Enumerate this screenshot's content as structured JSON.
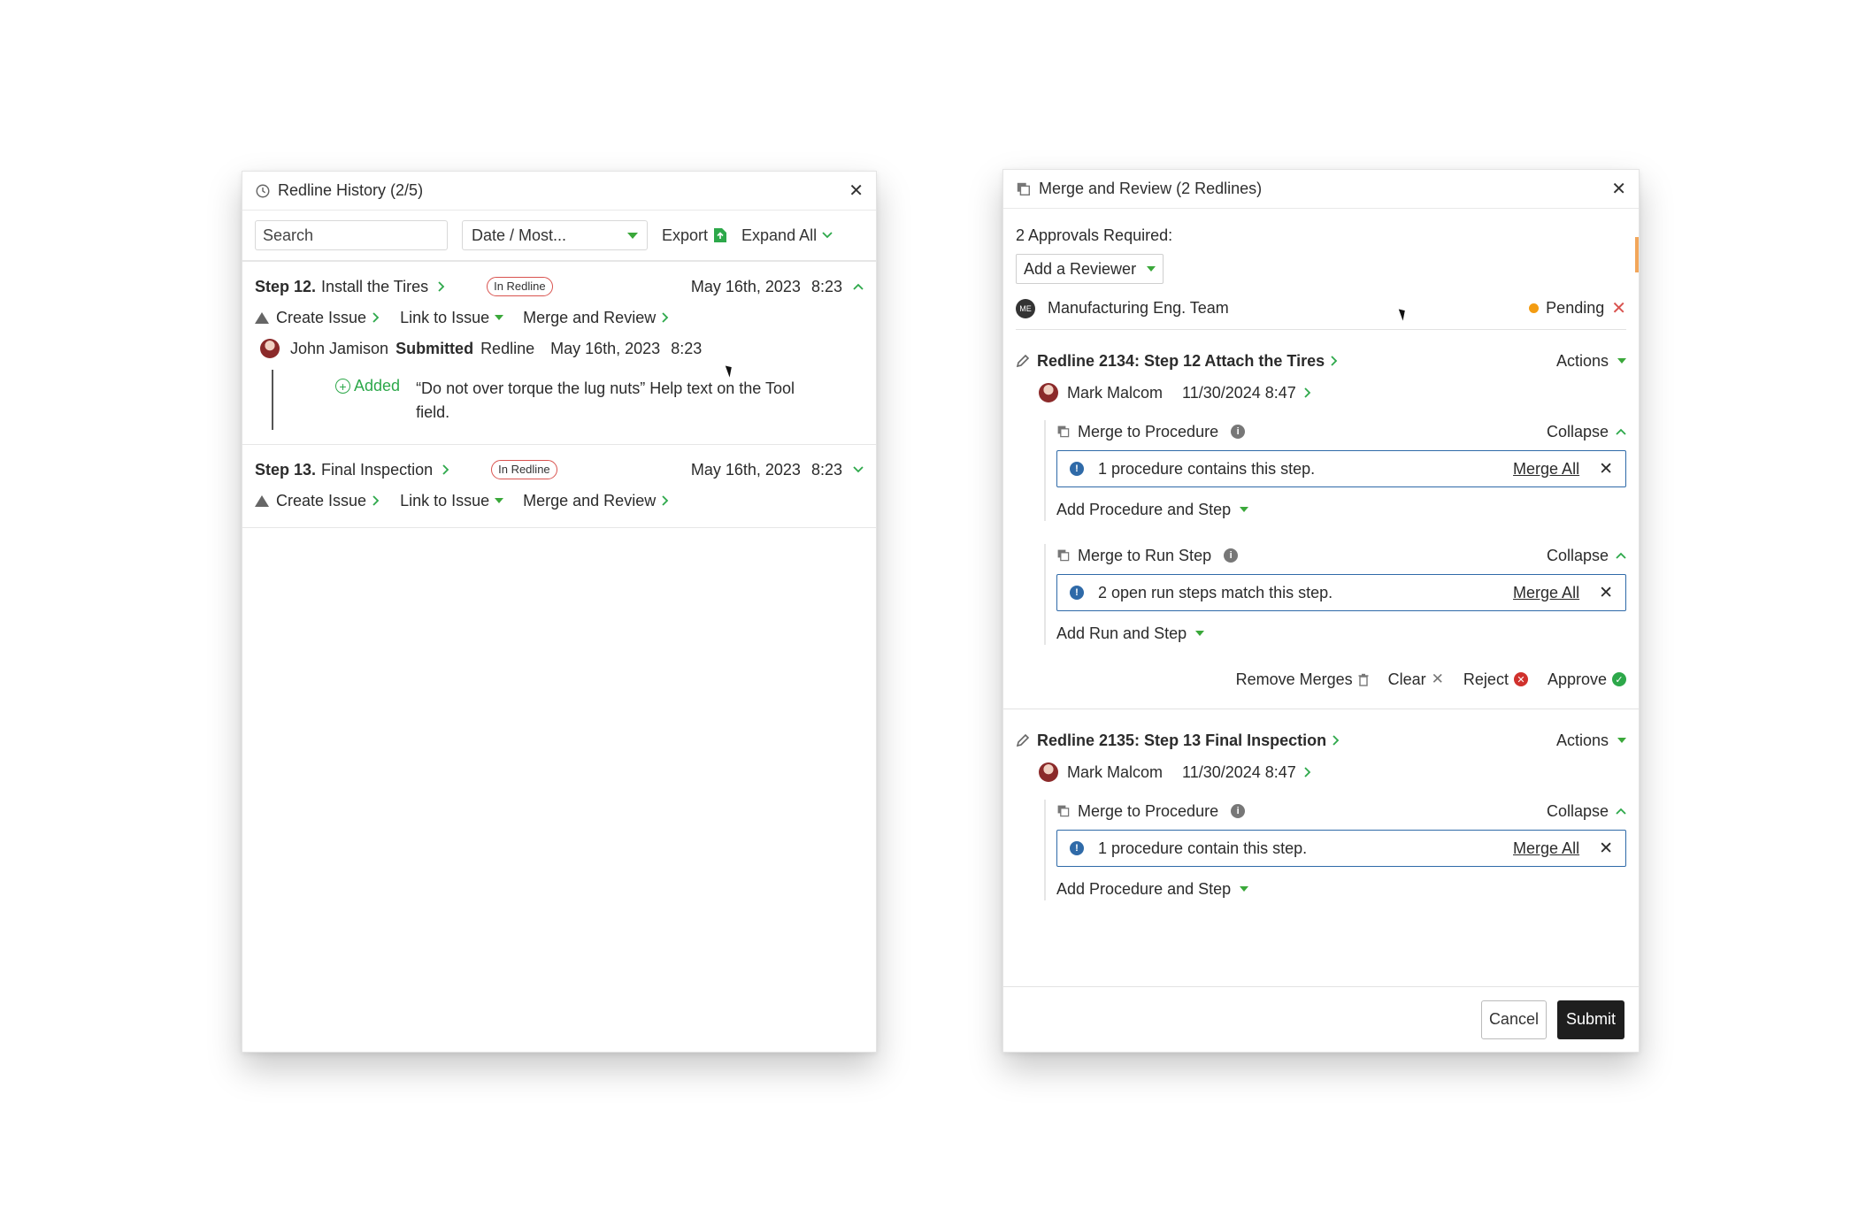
{
  "history": {
    "title": "Redline History (2/5)",
    "search_placeholder": "Search",
    "sort_value": "Date / Most...",
    "export_label": "Export",
    "expand_label": "Expand All",
    "steps": [
      {
        "num": "Step 12.",
        "name": "Install the Tires",
        "badge": "In Redline",
        "date": "May 16th, 2023",
        "time": "8:23",
        "create_issue": "Create Issue",
        "link_issue": "Link to Issue",
        "merge_review": "Merge and Review",
        "user": "John Jamison",
        "verb": "Submitted",
        "noun": "Redline",
        "sub_date": "May 16th, 2023",
        "sub_time": "8:23",
        "added_label": "Added",
        "change_text": "“Do not over torque the lug nuts” Help text on the Tool field."
      },
      {
        "num": "Step 13.",
        "name": "Final Inspection",
        "badge": "In Redline",
        "date": "May 16th, 2023",
        "time": "8:23",
        "create_issue": "Create Issue",
        "link_issue": "Link to Issue",
        "merge_review": "Merge and Review"
      }
    ]
  },
  "merge": {
    "title": "Merge and Review (2 Redlines)",
    "approvals": "2 Approvals Required:",
    "add_reviewer": "Add a Reviewer",
    "reviewer_initials": "ME",
    "reviewer_name": "Manufacturing Eng. Team",
    "reviewer_status": "Pending",
    "redlines": [
      {
        "title": "Redline 2134: Step 12  Attach the Tires",
        "actions": "Actions",
        "author": "Mark Malcom",
        "date": "11/30/2024 8:47",
        "groups": [
          {
            "title": "Merge to Procedure",
            "collapse": "Collapse",
            "notice": "1 procedure contains this step.",
            "merge_all": "Merge All",
            "add": "Add Procedure and Step"
          },
          {
            "title": "Merge to Run Step",
            "collapse": "Collapse",
            "notice": "2 open run steps match this step.",
            "merge_all": "Merge All",
            "add": "Add Run and Step"
          }
        ],
        "remove_merges": "Remove Merges",
        "clear": "Clear",
        "reject": "Reject",
        "approve": "Approve"
      },
      {
        "title": "Redline 2135: Step 13  Final Inspection",
        "actions": "Actions",
        "author": "Mark Malcom",
        "date": "11/30/2024 8:47",
        "groups": [
          {
            "title": "Merge to Procedure",
            "collapse": "Collapse",
            "notice": "1 procedure contain this step.",
            "merge_all": "Merge All",
            "add": "Add Procedure and Step"
          }
        ]
      }
    ],
    "cancel": "Cancel",
    "submit": "Submit"
  },
  "colors": {
    "accent_green": "#2da84a",
    "notice_blue": "#2f6aa8",
    "reject_red": "#d0312d",
    "pending_orange": "#f39c12"
  }
}
